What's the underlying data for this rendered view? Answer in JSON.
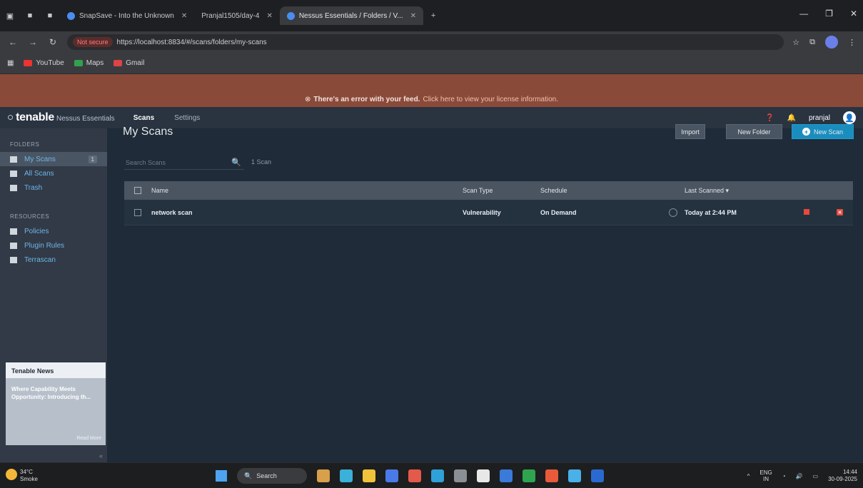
{
  "browser": {
    "tabs": [
      {
        "label": "SnapSave - Into the Unknown",
        "active": false
      },
      {
        "label": "Pranjal1505/day-4",
        "active": false
      },
      {
        "label": "Nessus Essentials / Folders / V...",
        "active": true
      }
    ],
    "url": "https://localhost:8834/#/scans/folders/my-scans",
    "not_secure_label": "Not secure",
    "bookmarks": [
      "YouTube",
      "Maps",
      "Gmail"
    ]
  },
  "error_banner": {
    "text": "There's an error with your feed.",
    "link": "Click here to view your license information."
  },
  "app": {
    "brand": "tenable",
    "product": "Nessus Essentials",
    "nav": [
      "Scans",
      "Settings"
    ],
    "user": "pranjal"
  },
  "sidebar": {
    "folders_label": "FOLDERS",
    "folders": [
      {
        "label": "My Scans",
        "count": "1",
        "active": true,
        "icon": "folder-icon"
      },
      {
        "label": "All Scans",
        "active": false,
        "icon": "list-icon"
      },
      {
        "label": "Trash",
        "active": false,
        "icon": "trash-icon"
      }
    ],
    "resources_label": "RESOURCES",
    "resources": [
      {
        "label": "Policies",
        "icon": "shield-icon"
      },
      {
        "label": "Plugin Rules",
        "icon": "plugin-icon"
      },
      {
        "label": "Terrascan",
        "icon": "scan-icon"
      }
    ],
    "news": {
      "title": "Tenable News",
      "headline": "Where Capability Meets Opportunity: Introducing th...",
      "read_more": "Read More"
    }
  },
  "main": {
    "title": "My Scans",
    "buttons": {
      "import": "Import",
      "new_folder": "New Folder",
      "new_scan": "New Scan"
    },
    "search_placeholder": "Search Scans",
    "scan_count": "1 Scan",
    "columns": {
      "name": "Name",
      "type": "Scan Type",
      "schedule": "Schedule",
      "last": "Last Scanned ▾"
    },
    "rows": [
      {
        "name": "network scan",
        "type": "Vulnerability",
        "schedule": "On Demand",
        "last": "Today at 2:44 PM"
      }
    ]
  },
  "taskbar": {
    "weather_temp": "34°C",
    "weather_desc": "Smoke",
    "search": "Search",
    "lang": "ENG",
    "region": "IN",
    "time": "14:44",
    "date": "30-09-2025"
  },
  "colors": {
    "accent": "#1a8dbf",
    "danger": "#e8493a",
    "appbar": "#2a3340",
    "error_bar": "#8a4a3a"
  }
}
